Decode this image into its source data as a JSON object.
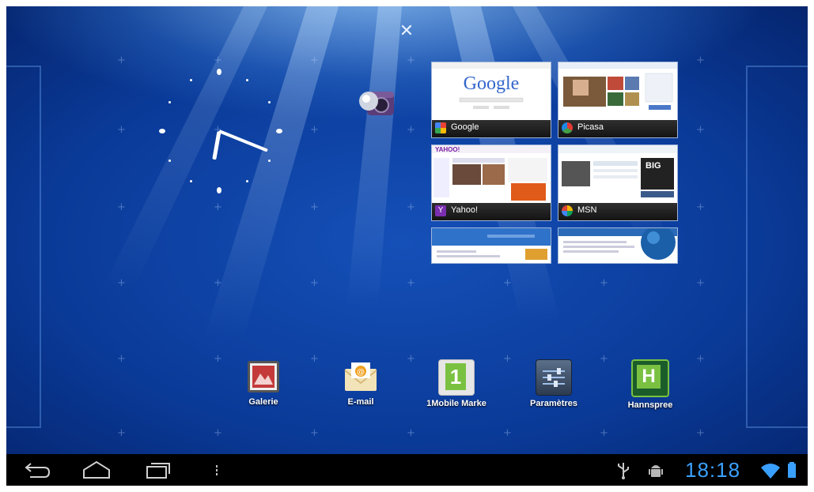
{
  "home": {
    "close_label": "✕",
    "bookmarks": [
      {
        "title": "Google",
        "shot_text": "Google"
      },
      {
        "title": "Picasa"
      },
      {
        "title": "Yahoo!",
        "shot_text": "YAHOO!"
      },
      {
        "title": "MSN",
        "shot_text": "BIG"
      },
      {
        "title": ""
      },
      {
        "title": ""
      }
    ],
    "clock_widget": {
      "hours": 9,
      "minutes": 17
    }
  },
  "dock": {
    "apps": [
      {
        "label": "Galerie",
        "icon": "gallery-icon"
      },
      {
        "label": "E-mail",
        "icon": "email-icon"
      },
      {
        "label": "1Mobile Marke",
        "icon": "1mobile-market-icon",
        "glyph": "1"
      },
      {
        "label": "Paramètres",
        "icon": "settings-icon"
      },
      {
        "label": "Hannspree",
        "icon": "hannspree-icon",
        "glyph": "H"
      }
    ]
  },
  "status_bar": {
    "time": "18:18",
    "icons": [
      "usb-icon",
      "android-debug-icon",
      "wifi-icon",
      "battery-icon"
    ]
  },
  "colors": {
    "accent": "#3aa0ff",
    "navbar": "#000000",
    "wallpaper": "#0a3a98"
  }
}
